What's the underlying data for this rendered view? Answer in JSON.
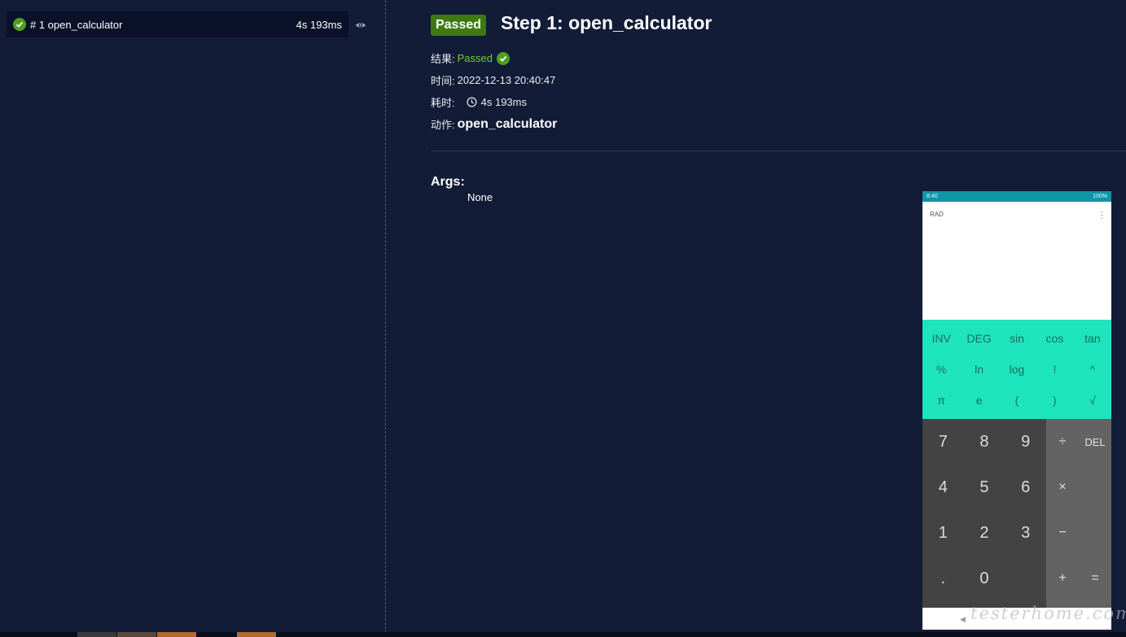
{
  "sidebar": {
    "steps": [
      {
        "label": "# 1 open_calculator",
        "duration": "4s 193ms",
        "status": "passed"
      }
    ]
  },
  "detail": {
    "badge": "Passed",
    "title": "Step 1: open_calculator",
    "result_label": "结果:",
    "result_value": "Passed",
    "time_label": "时间:",
    "time_value": "2022-12-13 20:40:47",
    "duration_label": "耗时:",
    "duration_value": "4s 193ms",
    "action_label": "动作:",
    "action_value": "open_calculator",
    "args_heading": "Args:",
    "args_value": "None"
  },
  "screenshot": {
    "status_time": "8:40",
    "battery": "100%",
    "mode": "RAD",
    "sci_keys": [
      "INV",
      "DEG",
      "sin",
      "cos",
      "tan",
      "%",
      "ln",
      "log",
      "!",
      "^",
      "π",
      "e",
      "(",
      ")",
      "√"
    ],
    "num_keys": [
      "7",
      "8",
      "9",
      "4",
      "5",
      "6",
      "1",
      "2",
      "3",
      ".",
      "0",
      ""
    ],
    "op_keys": [
      "÷",
      "DEL",
      "×",
      "",
      "−",
      "",
      "+",
      "="
    ]
  },
  "watermark": "testerhome.com",
  "colors": {
    "background": "#131c36",
    "passed_badge": "#3e7a10",
    "passed_text": "#6ecf3a",
    "check": "#4fa022",
    "sci_panel": "#1ee4bd",
    "status_bar": "#0e97a6"
  }
}
